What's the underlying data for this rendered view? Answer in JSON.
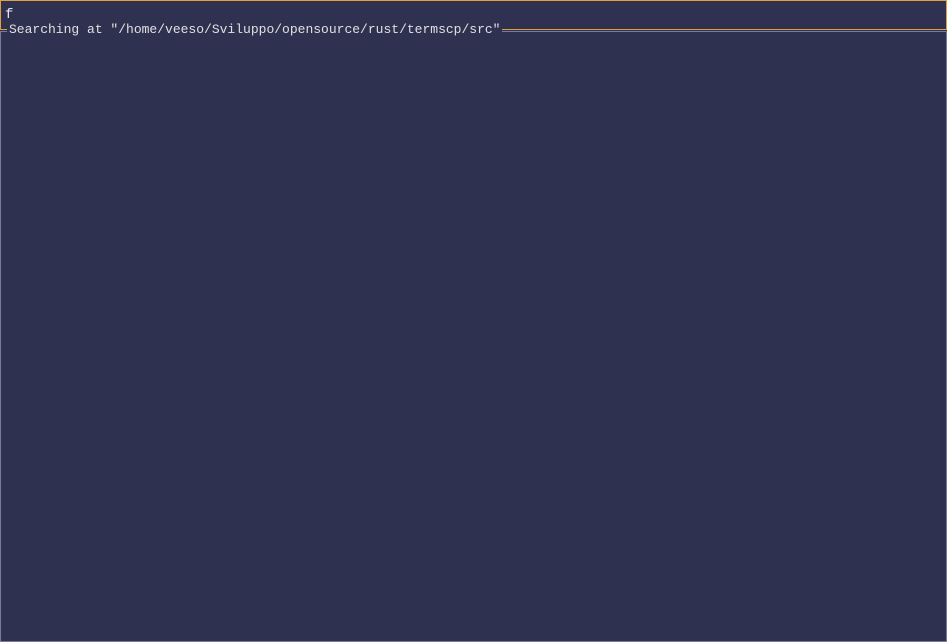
{
  "terminal": {
    "background_color": "#2e3250",
    "border_color_input": "#e0a040",
    "border_color_panel": "#7a7a9a"
  },
  "search_input": {
    "value": "f",
    "placeholder": ""
  },
  "results_panel": {
    "title": "Searching at \"/home/veeso/Sviluppo/opensource/rust/termscp/src\""
  }
}
